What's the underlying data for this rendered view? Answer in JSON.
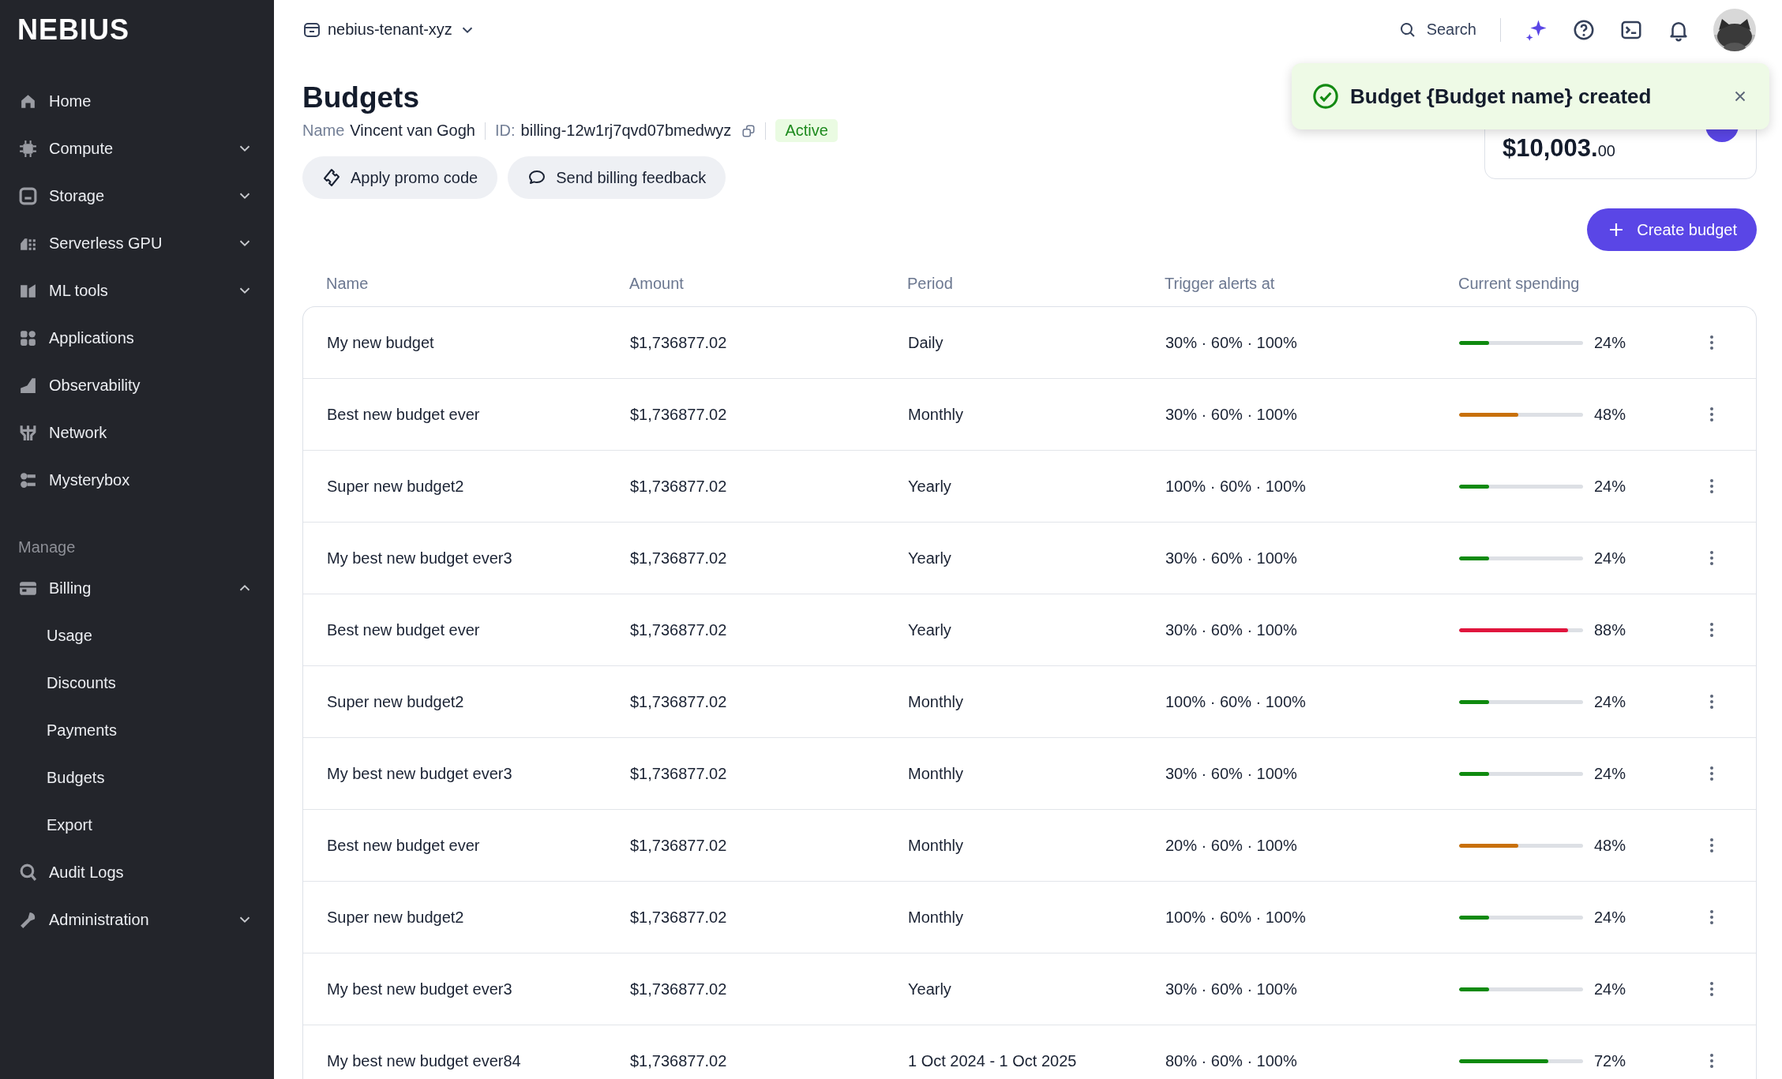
{
  "sidebar": {
    "logo": "NEBIUS",
    "items": [
      {
        "label": "Home"
      },
      {
        "label": "Compute",
        "expanded": false
      },
      {
        "label": "Storage",
        "expanded": false
      },
      {
        "label": "Serverless GPU",
        "expanded": false
      },
      {
        "label": "ML tools",
        "expanded": false
      },
      {
        "label": "Applications"
      },
      {
        "label": "Observability"
      },
      {
        "label": "Network"
      },
      {
        "label": "Mysterybox"
      }
    ],
    "section_title": "Manage",
    "manage_items": [
      {
        "label": "Billing",
        "expanded": true,
        "children": [
          {
            "label": "Usage"
          },
          {
            "label": "Discounts"
          },
          {
            "label": "Payments"
          },
          {
            "label": "Budgets"
          },
          {
            "label": "Export"
          }
        ]
      },
      {
        "label": "Audit Logs"
      },
      {
        "label": "Administration",
        "expanded": false
      }
    ]
  },
  "topbar": {
    "tenant": "nebius-tenant-xyz",
    "search": "Search"
  },
  "page": {
    "title": "Budgets",
    "name_label": "Name",
    "name": "Vincent van Gogh",
    "id_label": "ID:",
    "id": "billing-12w1rj7qvd07bmedwyz",
    "status": "Active",
    "buttons": [
      "Apply promo code",
      "Send billing feedback"
    ]
  },
  "balance": {
    "amount": "$10,003.",
    "cents": "00"
  },
  "create_button": "Create budget",
  "toast": {
    "message": "Budget {Budget name} created"
  },
  "table": {
    "columns": [
      "Name",
      "Amount",
      "Period",
      "Trigger alerts at",
      "Current spending"
    ],
    "rows": [
      {
        "name": "My new budget",
        "amount": "$1,736877.02",
        "period": "Daily",
        "alerts": "30% · 60% · 100%",
        "level": 0.24,
        "color": "#0f8a0f",
        "reading": "24%"
      },
      {
        "name": "Best new budget ever",
        "amount": "$1,736877.02",
        "period": "Monthly",
        "alerts": "30% · 60% · 100%",
        "level": 0.48,
        "color": "#c8700a",
        "reading": "48%"
      },
      {
        "name": "Super new budget2",
        "amount": "$1,736877.02",
        "period": "Yearly",
        "alerts": "100% · 60% · 100%",
        "level": 0.24,
        "color": "#0f8a0f",
        "reading": "24%"
      },
      {
        "name": "My best new budget ever3",
        "amount": "$1,736877.02",
        "period": "Yearly",
        "alerts": "30% · 60% · 100%",
        "level": 0.24,
        "color": "#0f8a0f",
        "reading": "24%"
      },
      {
        "name": "Best new budget ever",
        "amount": "$1,736877.02",
        "period": "Yearly",
        "alerts": "30% · 60% · 100%",
        "level": 0.88,
        "color": "#e0153d",
        "reading": "88%"
      },
      {
        "name": "Super new budget2",
        "amount": "$1,736877.02",
        "period": "Monthly",
        "alerts": "100% · 60% · 100%",
        "level": 0.24,
        "color": "#0f8a0f",
        "reading": "24%"
      },
      {
        "name": "My best new budget ever3",
        "amount": "$1,736877.02",
        "period": "Monthly",
        "alerts": "30% · 60% · 100%",
        "level": 0.24,
        "color": "#0f8a0f",
        "reading": "24%"
      },
      {
        "name": "Best new budget ever",
        "amount": "$1,736877.02",
        "period": "Monthly",
        "alerts": "20% · 60% · 100%",
        "level": 0.48,
        "color": "#c8700a",
        "reading": "48%"
      },
      {
        "name": "Super new budget2",
        "amount": "$1,736877.02",
        "period": "Monthly",
        "alerts": "100% · 60% · 100%",
        "level": 0.24,
        "color": "#0f8a0f",
        "reading": "24%"
      },
      {
        "name": "My best new budget ever3",
        "amount": "$1,736877.02",
        "period": "Yearly",
        "alerts": "30% · 60% · 100%",
        "level": 0.24,
        "color": "#0f8a0f",
        "reading": "24%"
      },
      {
        "name": "My best new budget ever84",
        "amount": "$1,736877.02",
        "period": "1 Oct 2024 - 1 Oct 2025",
        "alerts": "80% · 60% · 100%",
        "level": 0.72,
        "color": "#0f8a0f",
        "reading": "72%"
      }
    ]
  }
}
